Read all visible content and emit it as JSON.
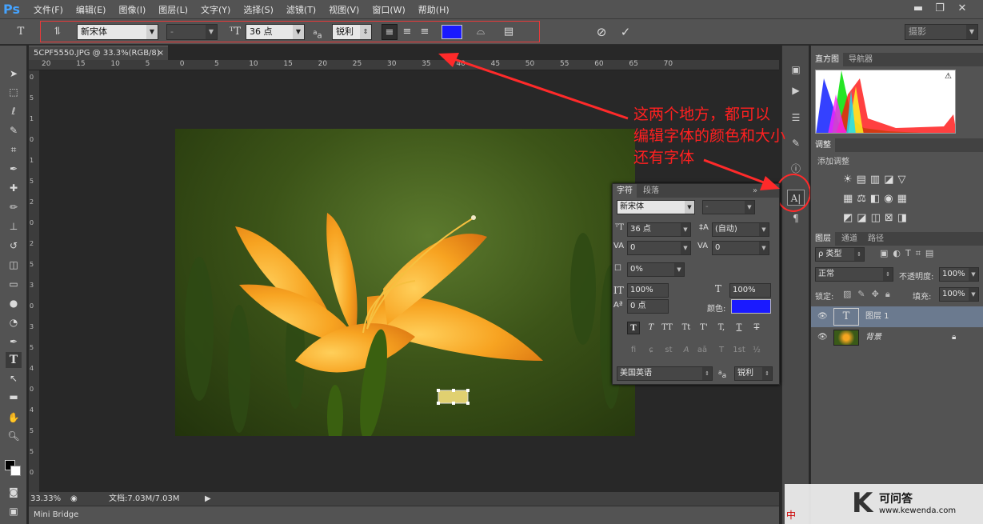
{
  "app": {
    "logo": "Ps"
  },
  "menu": [
    "文件(F)",
    "编辑(E)",
    "图像(I)",
    "图层(L)",
    "文字(Y)",
    "选择(S)",
    "滤镜(T)",
    "视图(V)",
    "窗口(W)",
    "帮助(H)"
  ],
  "window_controls": {
    "minimize": "▬",
    "restore": "❐",
    "close": "✕"
  },
  "options": {
    "tool_glyph": "T",
    "font_family": "新宋体",
    "font_style": "-",
    "font_size": "36 点",
    "aa_label": "a",
    "aa_value": "锐利",
    "text_color": "#1a1aff",
    "workspace": "摄影"
  },
  "document": {
    "tab_title": "5CPF5550.JPG @ 33.3%(RGB/8)",
    "tab_close": "×",
    "ruler_h": [
      "20",
      "15",
      "10",
      "5",
      "0",
      "5",
      "10",
      "15",
      "20",
      "25",
      "30",
      "35",
      "40",
      "45",
      "50",
      "55",
      "60",
      "65",
      "70"
    ],
    "ruler_v": [
      "0",
      "5",
      "1",
      "0",
      "1",
      "5",
      "2",
      "0",
      "2",
      "5",
      "3",
      "0",
      "3",
      "5",
      "4",
      "0",
      "4",
      "5",
      "5",
      "0"
    ],
    "zoom": "33.33%",
    "doc_info": "文档:7.03M/7.03M"
  },
  "minibridge": "Mini Bridge",
  "character_panel": {
    "tabs": [
      "字符",
      "段落"
    ],
    "font_family": "新宋体",
    "font_style": "-",
    "size": "36 点",
    "leading": "(自动)",
    "kerning": "0",
    "tracking": "0",
    "tsume": "0%",
    "vscale": "100%",
    "hscale": "100%",
    "baseline": "0 点",
    "color_label": "颜色:",
    "color": "#1a1aff",
    "styles": [
      "T",
      "T",
      "TT",
      "Tt",
      "T'",
      "T,",
      "T",
      "T"
    ],
    "ot_features": [
      "fi",
      "ɕ",
      "st",
      "A",
      "aā",
      "T",
      "1st",
      "½"
    ],
    "language": "美国英语",
    "aa_label": "a",
    "aa_value": "锐利"
  },
  "annotation": [
    "这两个地方，都可以",
    "编辑字体的颜色和大小",
    "还有字体"
  ],
  "panels": {
    "histogram_tabs": [
      "直方图",
      "导航器"
    ],
    "adjust_tab": "调整",
    "adjust_title": "添加调整",
    "layers_tabs": [
      "图层",
      "通道",
      "路径"
    ],
    "filter_kind": "ρ 类型",
    "blend_mode": "正常",
    "opacity_label": "不透明度:",
    "opacity": "100%",
    "lock_label": "锁定:",
    "fill_label": "填充:",
    "fill": "100%",
    "layers": [
      {
        "name": "图层 1",
        "kind": "T"
      },
      {
        "name": "背景",
        "kind": "bg"
      }
    ]
  },
  "watermark": {
    "brand": "可问答",
    "url": "www.kewenda.com",
    "ime": "中"
  }
}
